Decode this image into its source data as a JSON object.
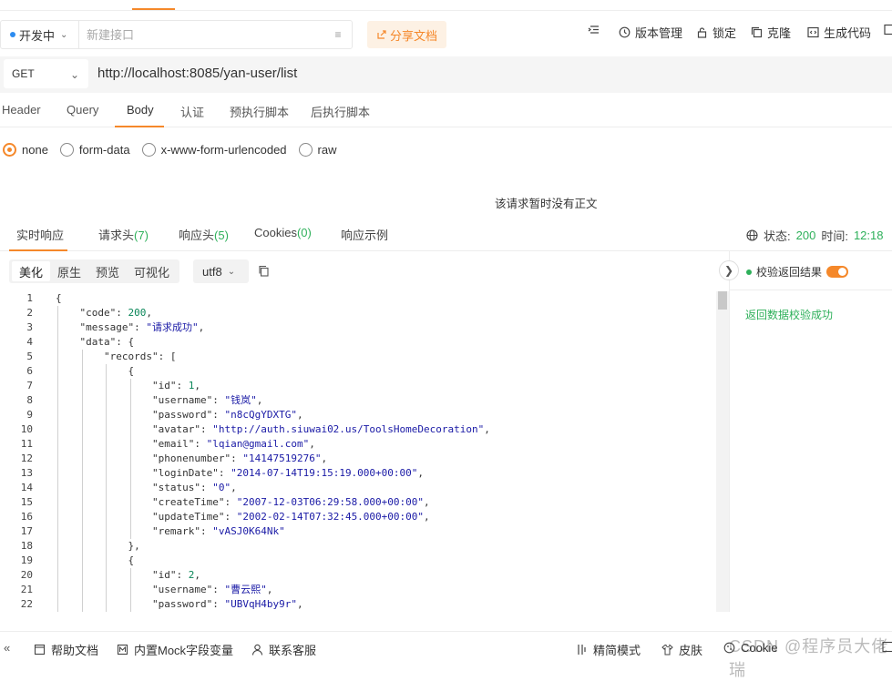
{
  "toolbar": {
    "env_label": "开发中",
    "api_name_placeholder": "新建接口",
    "share_label": "分享文档",
    "actions": [
      {
        "label": "版本管理",
        "icon": "clock-icon"
      },
      {
        "label": "锁定",
        "icon": "lock-icon"
      },
      {
        "label": "克隆",
        "icon": "clone-icon"
      },
      {
        "label": "生成代码",
        "icon": "code-icon"
      }
    ]
  },
  "request": {
    "method": "GET",
    "url": "http://localhost:8085/yan-user/list",
    "tabs": [
      "Header",
      "Query",
      "Body",
      "认证",
      "预执行脚本",
      "后执行脚本"
    ],
    "active_tab": "Body",
    "body_types": [
      "none",
      "form-data",
      "x-www-form-urlencoded",
      "raw"
    ],
    "selected_body_type": "none",
    "empty_body_text": "该请求暂时没有正文"
  },
  "response": {
    "tabs": [
      {
        "label": "实时响应",
        "count": ""
      },
      {
        "label": "请求头",
        "count": "(7)"
      },
      {
        "label": "响应头",
        "count": "(5)"
      },
      {
        "label": "Cookies",
        "count": "(0)"
      },
      {
        "label": "响应示例",
        "count": ""
      }
    ],
    "status_label": "状态:",
    "status_code": "200",
    "time_label": "时间:",
    "time_value": "12:18",
    "view_modes": [
      "美化",
      "原生",
      "预览",
      "可视化"
    ],
    "active_view": "美化",
    "encoding": "utf8",
    "lines": [
      "{",
      "\"code\": 200,",
      "\"message\": \"请求成功\",",
      "\"data\": {",
      "\"records\": [",
      "{",
      "\"id\": 1,",
      "\"username\": \"钱岚\",",
      "\"password\": \"n8cQgYDXTG\",",
      "\"avatar\": \"http://auth.siuwai02.us/ToolsHomeDecoration\",",
      "\"email\": \"lqian@gmail.com\",",
      "\"phonenumber\": \"14147519276\",",
      "\"loginDate\": \"2014-07-14T19:15:19.000+00:00\",",
      "\"status\": \"0\",",
      "\"createTime\": \"2007-12-03T06:29:58.000+00:00\",",
      "\"updateTime\": \"2002-02-14T07:32:45.000+00:00\",",
      "\"remark\": \"vASJ0K64Nk\"",
      "},",
      "{",
      "\"id\": 2,",
      "\"username\": \"曹云熙\",",
      "\"password\": \"UBVqH4by9r\","
    ],
    "verify_label": "校验返回结果",
    "verify_result": "返回数据校验成功"
  },
  "footer": {
    "items": [
      {
        "label": "帮助文档",
        "icon": "doc-icon"
      },
      {
        "label": "内置Mock字段变量",
        "icon": "mock-icon"
      },
      {
        "label": "联系客服",
        "icon": "user-icon"
      }
    ],
    "right_items": [
      {
        "label": "精简模式",
        "icon": "compact-icon"
      },
      {
        "label": "皮肤",
        "icon": "shirt-icon"
      },
      {
        "label": "Cookie",
        "icon": "cookie-icon"
      }
    ],
    "watermark": "CSDN @程序员大佬瑞"
  },
  "colors": {
    "accent": "#f5882a",
    "success": "#2eb05a",
    "env_dot": "#2d8cf0"
  }
}
